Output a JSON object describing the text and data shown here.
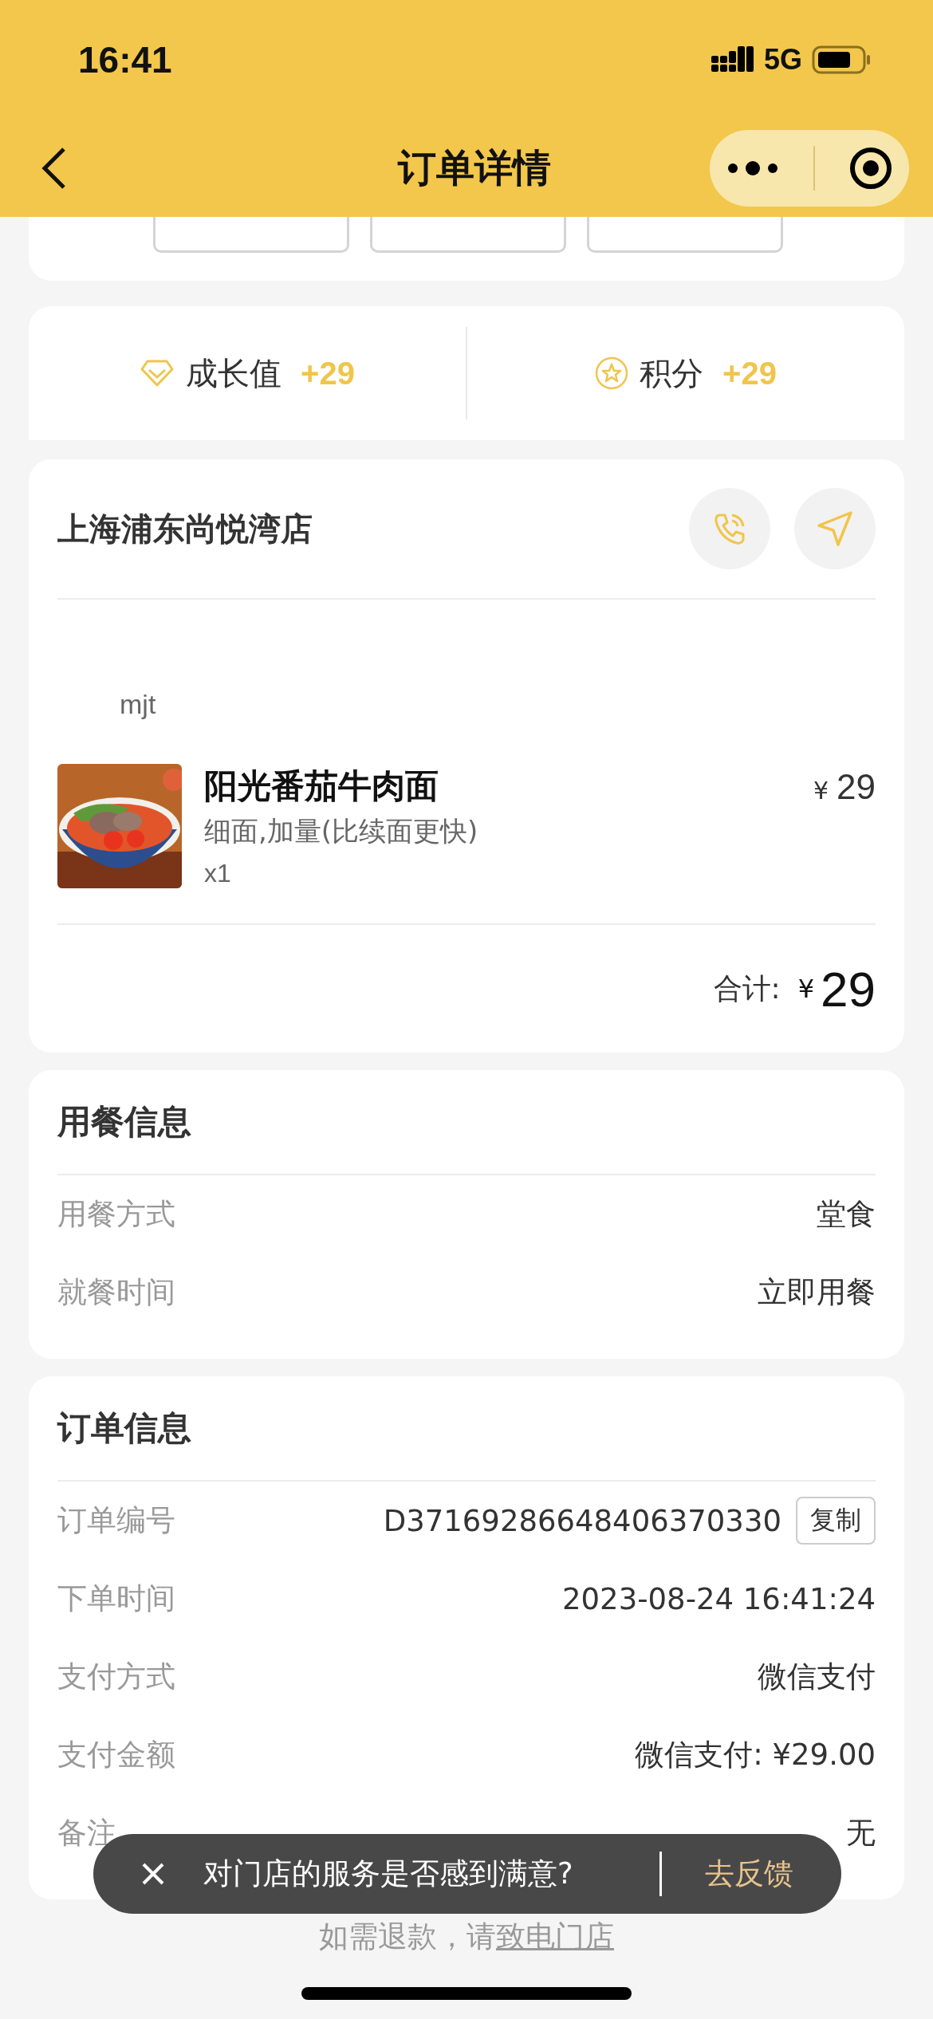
{
  "status_bar": {
    "time": "16:41",
    "network": "5G"
  },
  "nav": {
    "title": "订单详情"
  },
  "action_buttons": [
    {
      "kind": "outline"
    },
    {
      "kind": "outline"
    },
    {
      "kind": "outline"
    }
  ],
  "rewards": [
    {
      "kind": "growth",
      "label": "成长值",
      "value": "+29"
    },
    {
      "kind": "points",
      "label": "积分",
      "value": "+29"
    }
  ],
  "store": {
    "name": "上海浦东尚悦湾店",
    "note": "mjt",
    "items": [
      {
        "name": "阳光番茄牛肉面",
        "options": "细面,加量(比续面更快)",
        "quantity": "x1",
        "currency": "¥",
        "price": "29"
      }
    ],
    "total_label": "合计:",
    "total_currency": "¥",
    "total": "29"
  },
  "sections": [
    {
      "title": "用餐信息",
      "rows": [
        {
          "label": "用餐方式",
          "value": "堂食"
        },
        {
          "label": "就餐时间",
          "value": "立即用餐"
        }
      ]
    },
    {
      "title": "订单信息",
      "rows": [
        {
          "label": "订单编号",
          "value": "D37169286648406370330",
          "action": "复制"
        },
        {
          "label": "下单时间",
          "value": "2023-08-24 16:41:24"
        },
        {
          "label": "支付方式",
          "value": "微信支付"
        },
        {
          "label": "支付金额",
          "value": "微信支付: ¥29.00"
        },
        {
          "label": "备注",
          "value": "无"
        }
      ]
    }
  ],
  "footer": {
    "text": "如需退款，请",
    "link": "致电门店"
  },
  "toast": {
    "message": "对门店的服务是否感到满意?",
    "action": "去反馈"
  }
}
